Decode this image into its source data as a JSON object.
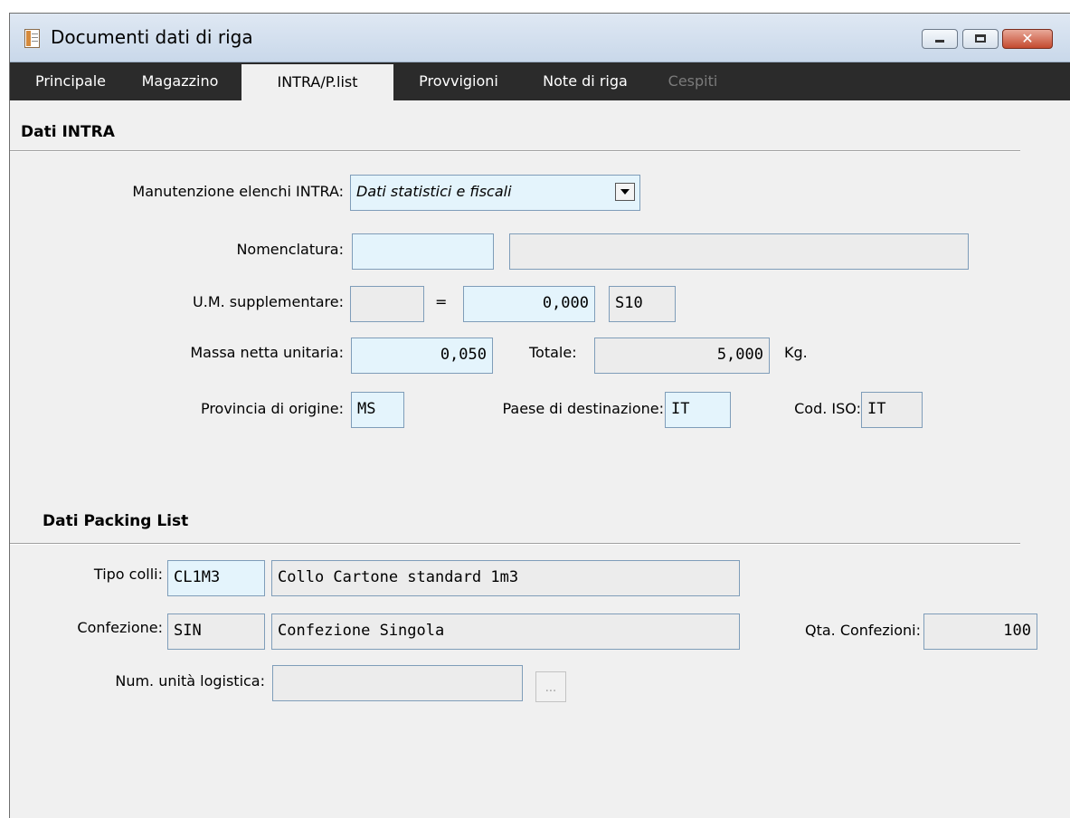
{
  "window": {
    "title": "Documenti dati di riga",
    "icon": "document-app-icon",
    "controls": {
      "minimize": "minimize-icon",
      "maximize": "maximize-icon",
      "close": "close-icon",
      "close_glyph": "✕"
    }
  },
  "tabs": [
    {
      "label": "Principale",
      "state": "normal"
    },
    {
      "label": "Magazzino",
      "state": "normal"
    },
    {
      "label": "INTRA/P.list",
      "state": "active"
    },
    {
      "label": "Provvigioni",
      "state": "normal"
    },
    {
      "label": "Note di riga",
      "state": "normal"
    },
    {
      "label": "Cespiti",
      "state": "disabled"
    }
  ],
  "intra": {
    "section_title": "Dati INTRA",
    "manutenzione": {
      "label": "Manutenzione elenchi INTRA:",
      "value": "Dati statistici e fiscali"
    },
    "nomenclatura": {
      "label": "Nomenclatura:",
      "code": "",
      "description": ""
    },
    "um_supplementare": {
      "label": "U.M. supplementare:",
      "um": "",
      "equals": "=",
      "value": "0,000",
      "unit": "S10"
    },
    "massa_netta": {
      "label": "Massa netta unitaria:",
      "value": "0,050",
      "totale_label": "Totale:",
      "totale": "5,000",
      "unit": "Kg."
    },
    "provincia": {
      "label": "Provincia di origine:",
      "value": "MS"
    },
    "paese": {
      "label": "Paese di destinazione:",
      "value": "IT"
    },
    "cod_iso": {
      "label": "Cod. ISO:",
      "value": "IT"
    }
  },
  "packing": {
    "section_title": "Dati Packing List",
    "tipo_colli": {
      "label": "Tipo colli:",
      "code": "CL1M3",
      "description": "Collo Cartone standard 1m3"
    },
    "confezione": {
      "label": "Confezione:",
      "code": "SIN",
      "description": "Confezione Singola"
    },
    "qta_confezioni": {
      "label": "Qta. Confezioni:",
      "value": "100"
    },
    "num_unita": {
      "label": "Num. unità logistica:",
      "value": "",
      "button": "..."
    }
  },
  "colors": {
    "tabbar": "#2b2b2b",
    "field_cyan": "#e4f4fc",
    "field_grey": "#ececec",
    "field_border": "#7f9db9"
  }
}
